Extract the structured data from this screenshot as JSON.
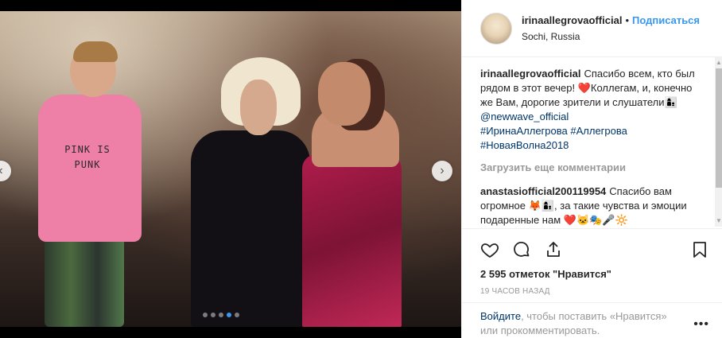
{
  "post": {
    "username": "irinaallegrovaofficial",
    "separator": "•",
    "follow_label": "Подписаться",
    "location": "Sochi, Russia",
    "shirt_text": "PINK IS PUNK",
    "nav_prev": "‹",
    "nav_next": "›",
    "carousel_dots": 5,
    "active_dot": 3
  },
  "caption": {
    "username": "irinaallegrovaofficial",
    "text_1": "Спасибо всем, кто был рядом в этот вечер!",
    "heart": "❤️",
    "text_2": "Коллегам, и, конечно же Вам, дорогие зрители и слушатели",
    "emoji_people": "👩‍👦",
    "mention": "@newwave_official",
    "tags": [
      "#ИринаАллегрова",
      "#Аллегрова",
      "#НоваяВолна2018"
    ]
  },
  "load_more_label": "Загрузить еще комментарии",
  "comment": {
    "username": "anastasiofficial200119954",
    "text_1": "Спасибо вам огромное",
    "emoji_1": "🦊👩‍👦",
    "text_2": ", за такие чувства и эмоции подаренные нам",
    "emoji_2": "❤️🐱🎭🎤🔆"
  },
  "scrollbar": {
    "up": "▲",
    "down": "▼"
  },
  "likes_text": "2 595 отметок \"Нравится\"",
  "time_text": "19 часов назад",
  "footer": {
    "login_link": "Войдите",
    "text_1": ", чтобы поставить «Нравится»",
    "text_2": "или прокомментировать.",
    "more_label": "•••"
  },
  "icons": {
    "like": "heart-icon",
    "comment": "comment-icon",
    "share": "share-icon",
    "save": "bookmark-icon"
  }
}
